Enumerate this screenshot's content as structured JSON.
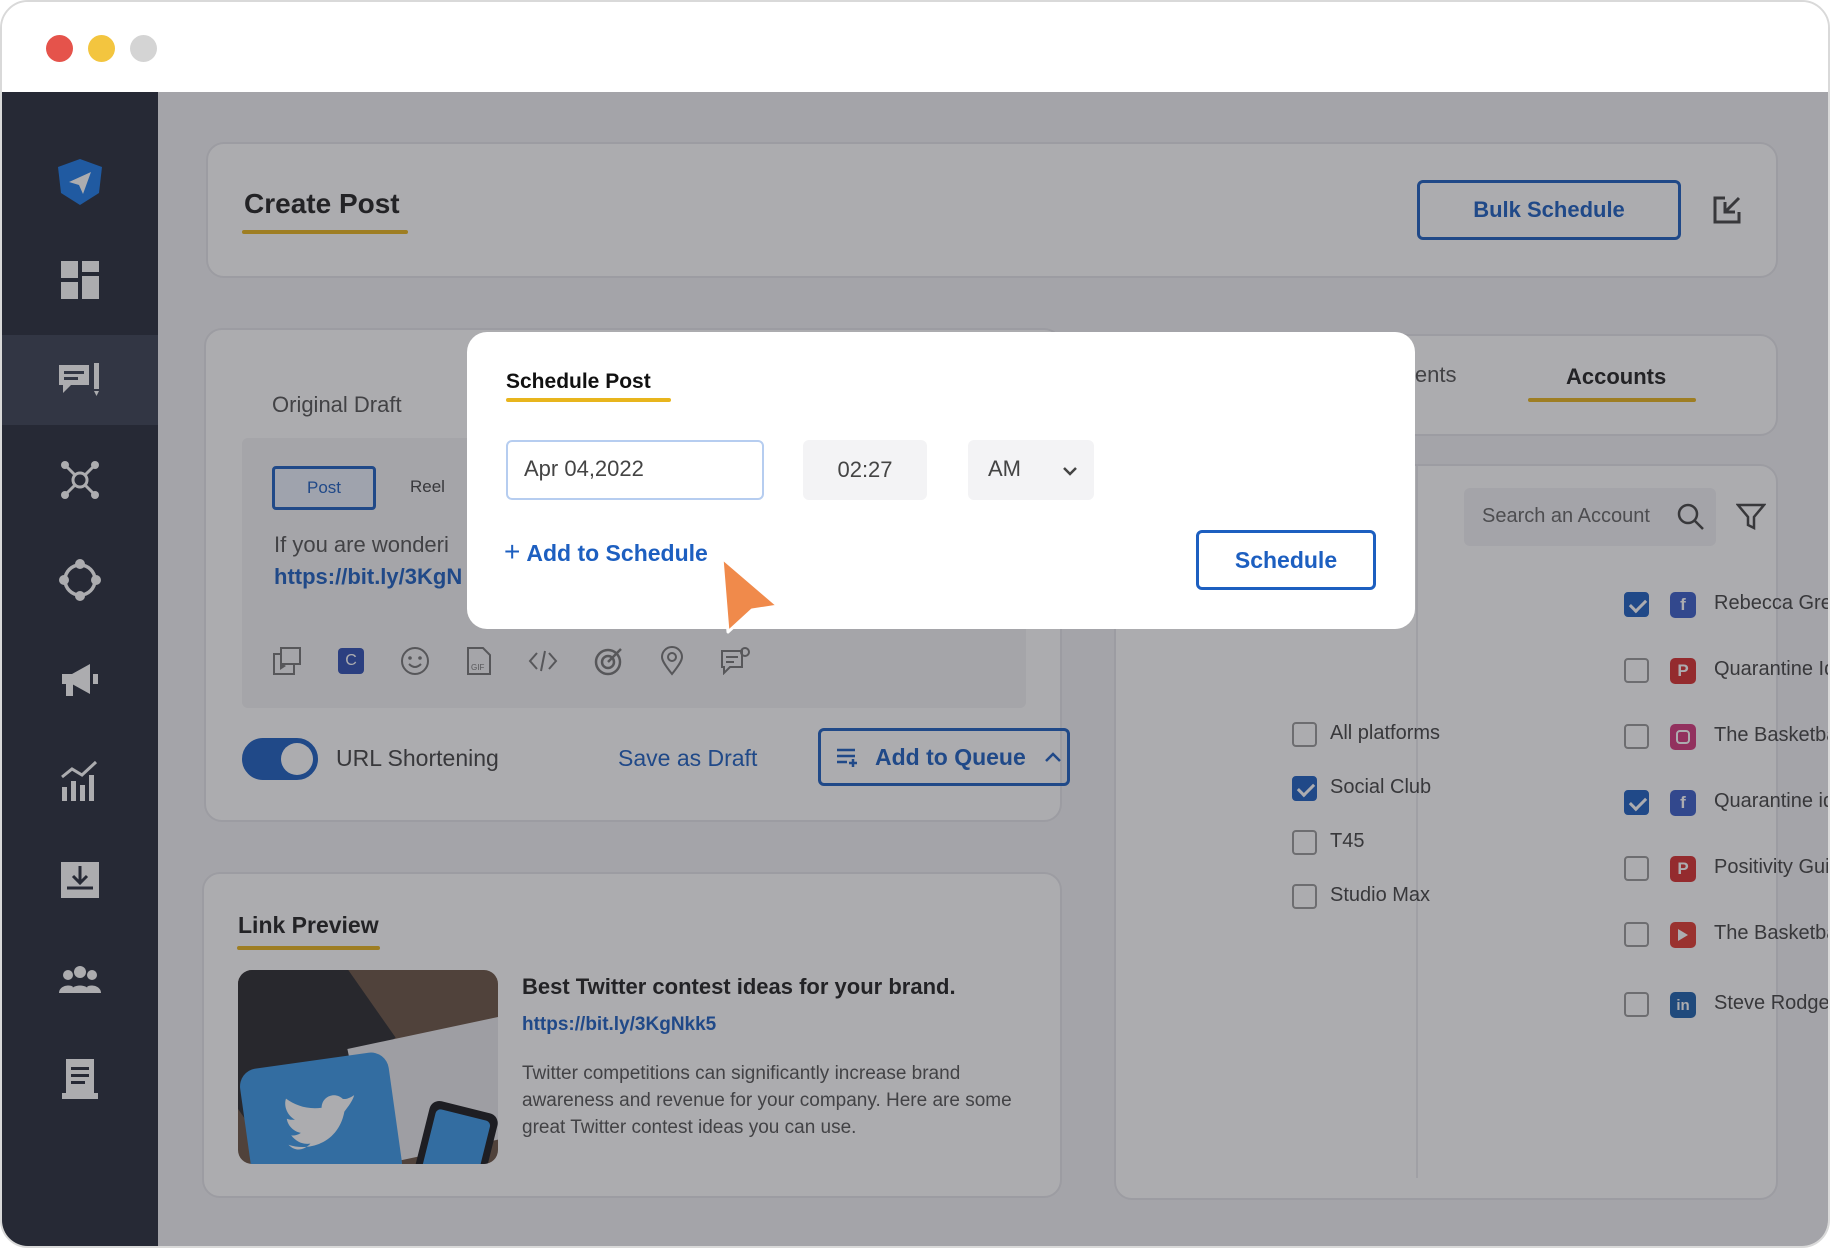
{
  "window": {
    "controls": [
      "close",
      "minimize",
      "maximize"
    ]
  },
  "sidebar": {
    "items": [
      {
        "name": "logo",
        "icon": "paper-plane-icon"
      },
      {
        "name": "dashboard",
        "icon": "dashboard-grid-icon"
      },
      {
        "name": "compose",
        "icon": "compose-post-icon",
        "active": true
      },
      {
        "name": "network",
        "icon": "network-nodes-icon"
      },
      {
        "name": "engage",
        "icon": "cycle-icon"
      },
      {
        "name": "campaigns",
        "icon": "megaphone-icon"
      },
      {
        "name": "analytics",
        "icon": "bar-chart-icon"
      },
      {
        "name": "inbox",
        "icon": "inbox-download-icon"
      },
      {
        "name": "team",
        "icon": "team-icon"
      },
      {
        "name": "reports",
        "icon": "document-icon"
      }
    ]
  },
  "header": {
    "title": "Create Post",
    "bulk_schedule": "Bulk Schedule",
    "export_icon": "export-icon"
  },
  "editor": {
    "draft_tab": "Original Draft",
    "post_types": [
      "Post",
      "Reel"
    ],
    "text": "If you are wonderi",
    "link": "https://bit.ly/3KgN",
    "toolbar_icons": [
      "media-icon",
      "canva-icon",
      "emoji-icon",
      "gif-icon",
      "code-icon",
      "target-icon",
      "location-icon",
      "comment-icon"
    ],
    "url_shortening": "URL Shortening",
    "save_draft": "Save as Draft",
    "add_to_queue": "Add to Queue"
  },
  "link_preview": {
    "label": "Link Preview",
    "title": "Best Twitter contest ideas for your brand.",
    "url": "https://bit.ly/3KgNkk5",
    "description": "Twitter competitions can significantly increase brand awareness and revenue for your company. Here are some great Twitter contest ideas you can use."
  },
  "right_panel": {
    "tabs": [
      "omments",
      "Accounts"
    ],
    "search_placeholder": "Search an Account",
    "groups": [
      {
        "label": "All platforms",
        "checked": false
      },
      {
        "label": "Social Club",
        "checked": true
      },
      {
        "label": "T45",
        "checked": false
      },
      {
        "label": "Studio Max",
        "checked": false
      }
    ],
    "accounts": [
      {
        "label": "Rebecca Green",
        "platform": "facebook",
        "checked": true
      },
      {
        "label": "Quarantine Ideas",
        "platform": "pinterest",
        "checked": false
      },
      {
        "label": "The Basketball Guy",
        "platform": "instagram",
        "checked": false
      },
      {
        "label": "Quarantine ideas",
        "platform": "facebook",
        "checked": true
      },
      {
        "label": "Positivity Guides",
        "platform": "pinterest",
        "checked": false
      },
      {
        "label": "The Basketball Guy",
        "platform": "youtube",
        "checked": false
      },
      {
        "label": "Steve Rodgers Inc.",
        "platform": "linkedin",
        "checked": false
      }
    ]
  },
  "modal": {
    "title": "Schedule Post",
    "date": "Apr 04,2022",
    "time": "02:27",
    "ampm": "AM",
    "add_to_schedule": "Add to Schedule",
    "schedule": "Schedule"
  },
  "colors": {
    "accent": "#1d5fc0",
    "underline": "#e8b51d",
    "sidebar": "#272d3b",
    "cursor": "#f08a4b"
  }
}
